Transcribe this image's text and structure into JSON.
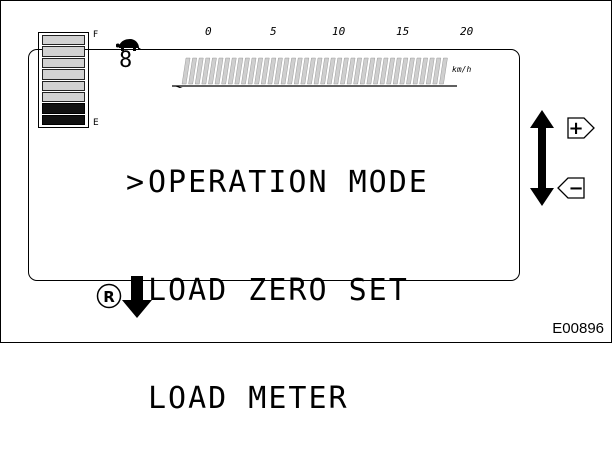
{
  "fuel_gauge": {
    "full_label": "F",
    "empty_label": "E",
    "total_segments": 8,
    "dark_segments": 2
  },
  "gear": "8",
  "speed_scale": {
    "ticks": [
      "0",
      "5",
      "10",
      "15",
      "20"
    ],
    "unit": "km/h"
  },
  "menu": {
    "cursor": ">",
    "items": [
      "OPERATION MODE",
      "LOAD ZERO SET",
      "LOAD METER"
    ],
    "selected_index": 0
  },
  "buttons": {
    "plus_label": "+",
    "minus_label": "−",
    "reset_label": "R"
  },
  "figure_code": "E00896"
}
